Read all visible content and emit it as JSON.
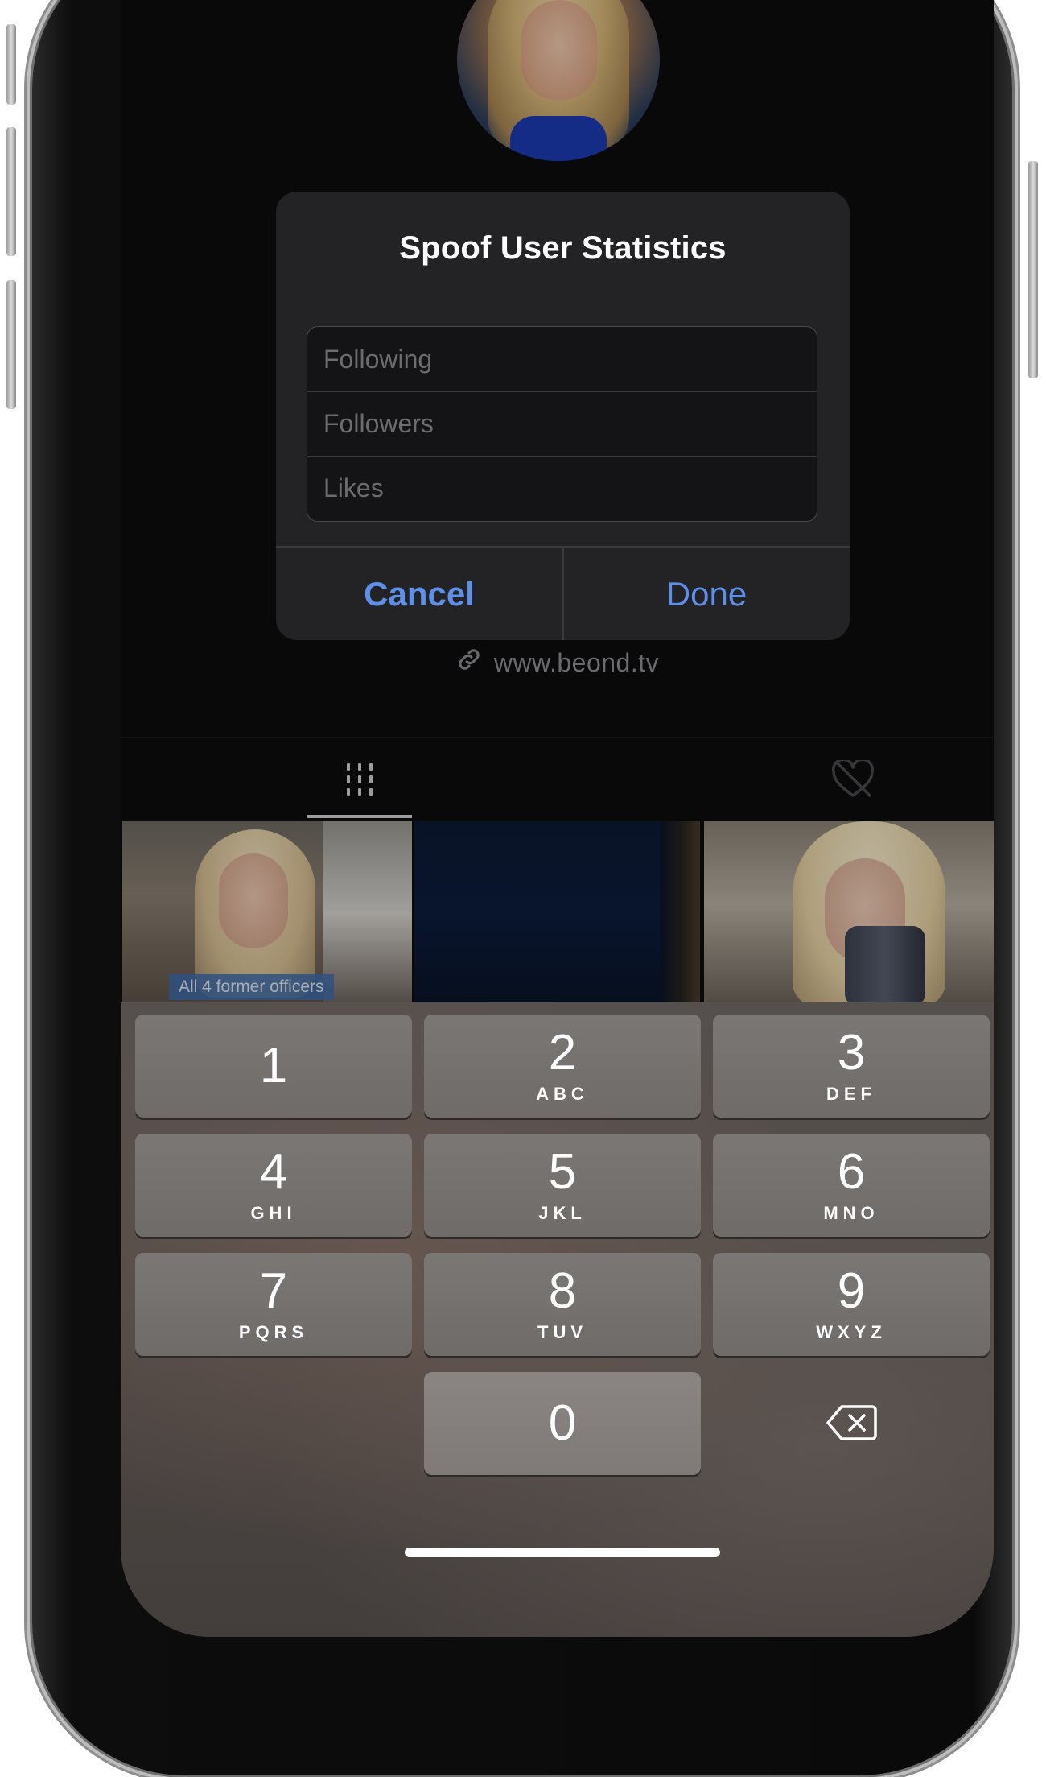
{
  "profile": {
    "link_text": "www.beond.tv"
  },
  "tabs": [
    {
      "name": "videos",
      "icon": "grid-icon",
      "selected": true
    },
    {
      "name": "liked",
      "icon": "heart-hidden-icon",
      "selected": false
    }
  ],
  "thumbnails": [
    {
      "label": "All 4 former officers"
    },
    {
      "label": ""
    },
    {
      "label": ""
    }
  ],
  "alert": {
    "title": "Spoof User Statistics",
    "fields": [
      {
        "placeholder": "Following",
        "value": ""
      },
      {
        "placeholder": "Followers",
        "value": ""
      },
      {
        "placeholder": "Likes",
        "value": ""
      }
    ],
    "cancel_label": "Cancel",
    "done_label": "Done",
    "accent_color": "#5e8fe9"
  },
  "keypad": {
    "keys": [
      {
        "digit": "1",
        "letters": ""
      },
      {
        "digit": "2",
        "letters": "ABC"
      },
      {
        "digit": "3",
        "letters": "DEF"
      },
      {
        "digit": "4",
        "letters": "GHI"
      },
      {
        "digit": "5",
        "letters": "JKL"
      },
      {
        "digit": "6",
        "letters": "MNO"
      },
      {
        "digit": "7",
        "letters": "PQRS"
      },
      {
        "digit": "8",
        "letters": "TUV"
      },
      {
        "digit": "9",
        "letters": "WXYZ"
      },
      {
        "digit": "0",
        "letters": ""
      }
    ],
    "delete_icon": "backspace-icon"
  }
}
